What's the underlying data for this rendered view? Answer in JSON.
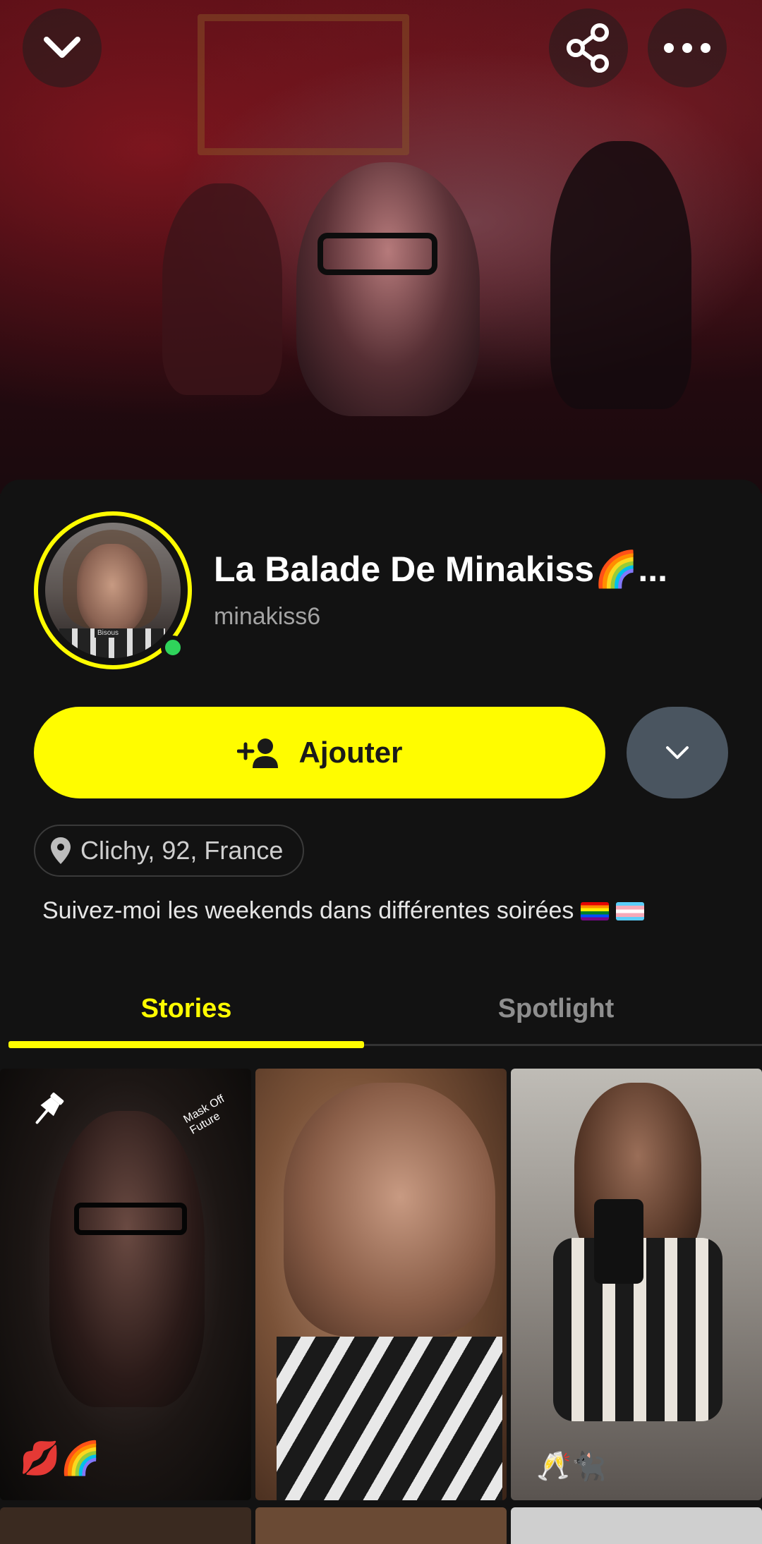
{
  "profile": {
    "display_name": "La Balade De Minakiss🌈...",
    "username": "minakiss6",
    "avatar_caption": "Bisous",
    "location": "Clichy, 92, France",
    "bio": "Suivez-moi les weekends dans différentes soirées",
    "online": true
  },
  "actions": {
    "add_label": "Ajouter"
  },
  "tabs": [
    {
      "label": "Stories",
      "active": true
    },
    {
      "label": "Spotlight",
      "active": false
    }
  ],
  "stories": [
    {
      "pinned": true,
      "badge": "Mask Off Future",
      "emoji": "💋🌈"
    },
    {
      "pinned": false
    },
    {
      "pinned": false,
      "emoji": "🥂🐈‍⬛"
    }
  ],
  "colors": {
    "accent_yellow": "#fffc00",
    "online_green": "#2fd35b",
    "background": "#121212",
    "secondary_button": "#4a5560"
  },
  "icons": {
    "collapse": "chevron-down-icon",
    "share": "share-icon",
    "more": "more-horizontal-icon",
    "add_friend": "add-friend-icon",
    "location": "location-pin-icon",
    "pin": "pin-icon"
  }
}
